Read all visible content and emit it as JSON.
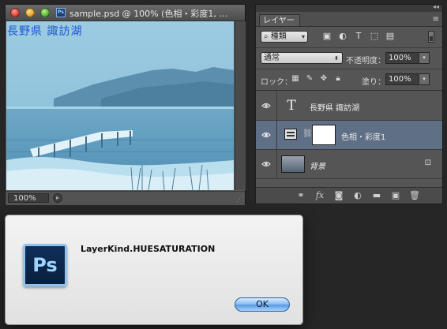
{
  "document_window": {
    "title": "sample.psd @ 100% (色相・彩度1, …",
    "canvas_caption": "長野県 諏訪湖",
    "zoom": "100%"
  },
  "layers_panel": {
    "tab_label": "レイヤー",
    "filter_kind": "種類",
    "blend_mode": "通常",
    "opacity_label": "不透明度：",
    "opacity_value": "100%",
    "lock_label": "ロック：",
    "fill_label": "塗り：",
    "fill_value": "100%",
    "layers": [
      {
        "name": "長野県 諏訪湖",
        "kind": "text",
        "visible": true,
        "selected": false
      },
      {
        "name": "色相・彩度1",
        "kind": "adjustment",
        "visible": true,
        "selected": true
      },
      {
        "name": "背景",
        "kind": "background",
        "visible": true,
        "selected": false,
        "locked": true
      }
    ],
    "icons": {
      "filter": [
        "image-filter-icon",
        "adjustment-filter-icon",
        "type-filter-icon",
        "shape-filter-icon",
        "smart-object-filter-icon"
      ],
      "lock": [
        "lock-transparent-icon",
        "lock-paint-icon",
        "lock-position-icon",
        "lock-all-icon"
      ],
      "footer": [
        "link-layers-icon",
        "fx-icon",
        "add-mask-icon",
        "new-adjustment-icon",
        "new-group-icon",
        "new-layer-icon",
        "delete-layer-icon"
      ]
    }
  },
  "alert": {
    "icon_text": "Ps",
    "message": "LayerKind.HUESATURATION",
    "ok_label": "OK"
  },
  "colors": {
    "canvas_tint": "#8ec3dc",
    "selected_layer": "#5f6f86",
    "caption_text": "#1b56d1",
    "ok_button": "#5a9be0"
  }
}
